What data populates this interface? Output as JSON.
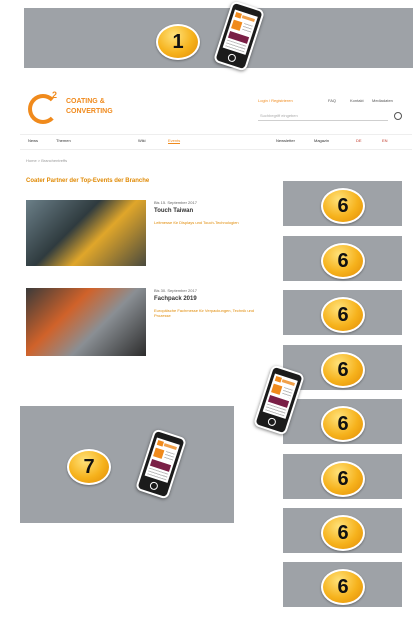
{
  "top_banner": {
    "badge": "1"
  },
  "header": {
    "brand_line1": "COATING &",
    "brand_line2": "CONVERTING",
    "top_links": [
      "Login / Registrieren",
      "FAQ",
      "Kontakt",
      "Mediadaten"
    ],
    "search_placeholder": "Suchbegriff eingeben"
  },
  "nav": {
    "items": [
      "News",
      "Themen",
      "Wiki",
      "Events"
    ],
    "right_items": [
      "Newsletter",
      "Magazin",
      "DE",
      "EN"
    ]
  },
  "breadcrumb": "Home > Branchentreffs",
  "section_title": "Coater Partner der Top-Events der Branche",
  "events": [
    {
      "date": "Bis 15. September 2017",
      "title": "Touch Taiwan",
      "desc": "Leitmesse für Displays und Touch-Technologien"
    },
    {
      "date": "Bis 30. September 2017",
      "title": "Fachpack 2019",
      "desc": "Europäische Fachmesse für Verpackungen, Technik und Prozesse"
    }
  ],
  "side_badges": [
    "6",
    "6",
    "6",
    "6",
    "6",
    "6",
    "6",
    "6"
  ],
  "bottom_banner": {
    "badge": "7"
  },
  "colors": {
    "ad_gray": "#9ea2a7",
    "badge_gold": "#f6b21c",
    "brand_orange": "#f08a1c",
    "brand_purple": "#7a1f46"
  }
}
